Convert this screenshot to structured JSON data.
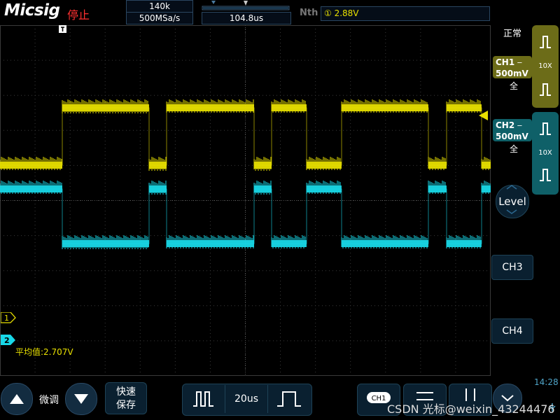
{
  "header": {
    "logo": "Micsig",
    "run_status": "停止",
    "memory_depth": "140k",
    "sample_rate": "500MSa/s",
    "trigger_position": "104.8us",
    "trigger_type": "Nth",
    "trigger_level": "① 2.88V"
  },
  "right_panel": {
    "trigger_mode": "正常",
    "ch1": {
      "label": "CH1",
      "coupling_icon": "dc-coupling-icon",
      "scale": "500mV",
      "bandwidth": "全",
      "probe": "10X"
    },
    "ch2": {
      "label": "CH2",
      "coupling_icon": "dc-coupling-icon",
      "scale": "500mV",
      "bandwidth": "全",
      "probe": "10X"
    },
    "level_label": "Level",
    "ch3_label": "CH3",
    "ch4_label": "CH4"
  },
  "waveform": {
    "ch1_marker": "1",
    "ch2_marker": "2",
    "measurement": "平均值:2.707V"
  },
  "bottom_bar": {
    "fine_label": "微调",
    "quick_save_line1": "快速",
    "quick_save_line2": "保存",
    "timebase": "20us",
    "ch1_badge": "CH1",
    "time": "14:28",
    "watermark": "CSDN 光标@weixin_43244476"
  },
  "colors": {
    "ch1": "#e8e000",
    "ch2": "#18d8e8",
    "accent": "#1e4256",
    "stop": "#ff3030"
  }
}
